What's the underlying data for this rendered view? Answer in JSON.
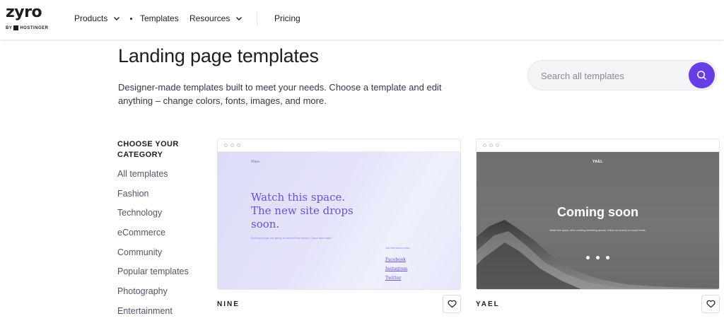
{
  "header": {
    "logo": {
      "mark": "zyro",
      "byline": "BY",
      "partner": "HOSTINGER"
    },
    "nav": [
      {
        "label": "Products",
        "has_dropdown": true
      },
      {
        "label": "Templates",
        "active": true
      },
      {
        "label": "Resources",
        "has_dropdown": true
      },
      {
        "label": "Pricing"
      }
    ]
  },
  "hero": {
    "title": "Landing page templates",
    "subtitle": "Designer-made templates built to meet your needs. Choose a template and edit anything – change colors, fonts, images, and more."
  },
  "search": {
    "placeholder": "Search all templates",
    "icon": "search-icon",
    "accent": "#673de6"
  },
  "sidebar": {
    "heading": "CHOOSE YOUR CATEGORY",
    "categories": [
      "All templates",
      "Fashion",
      "Technology",
      "eCommerce",
      "Community",
      "Popular templates",
      "Photography",
      "Entertainment"
    ]
  },
  "templates": [
    {
      "name": "NINE",
      "preview": {
        "brand": "Nine",
        "headline": "Watch this space. The new site drops soon.",
        "tagline": "Exciting things are going on behind the scenes. Come back soon!",
        "updates_label": "Get the latest news:",
        "links": [
          "Facebook",
          "Instagram",
          "Twitter"
        ],
        "accent": "#6a4fe0"
      }
    },
    {
      "name": "YAEL",
      "preview": {
        "brand": "YAEL",
        "headline": "Coming soon",
        "tagline": "Watch this space, we're creating something special. Follow our journey on social media."
      }
    }
  ]
}
